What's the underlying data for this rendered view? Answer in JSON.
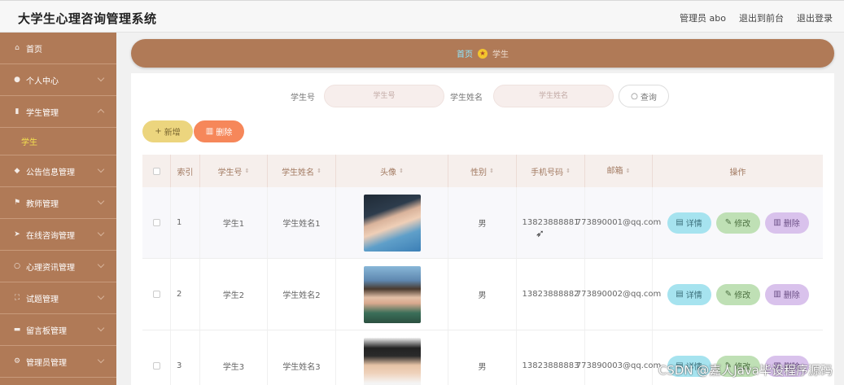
{
  "header": {
    "title": "大学生心理咨询管理系统",
    "admin_label": "管理员 abo",
    "to_front": "退出到前台",
    "logout": "退出登录"
  },
  "sidebar": {
    "items": [
      {
        "label": "首页",
        "icon": "home-icon"
      },
      {
        "label": "个人中心",
        "icon": "user-icon"
      },
      {
        "label": "学生管理",
        "icon": "bar-chart-icon",
        "submenu": "学生"
      },
      {
        "label": "公告信息管理",
        "icon": "bell-icon"
      },
      {
        "label": "教师管理",
        "icon": "flag-icon"
      },
      {
        "label": "在线咨询管理",
        "icon": "send-icon"
      },
      {
        "label": "心理资讯管理",
        "icon": "circle-icon"
      },
      {
        "label": "试题管理",
        "icon": "expand-icon"
      },
      {
        "label": "留言板管理",
        "icon": "briefcase-icon"
      },
      {
        "label": "管理员管理",
        "icon": "settings-icon"
      }
    ]
  },
  "breadcrumb": {
    "home": "首页",
    "current": "学生"
  },
  "search": {
    "student_no_label": "学生号",
    "student_no_placeholder": "学生号",
    "student_name_label": "学生姓名",
    "student_name_placeholder": "学生姓名",
    "query_button": "查询"
  },
  "toolbar": {
    "add_label": "新增",
    "delete_label": "删除"
  },
  "table": {
    "headers": {
      "index": "索引",
      "student_no": "学生号",
      "student_name": "学生姓名",
      "avatar": "头像",
      "gender": "性别",
      "phone": "手机号码",
      "email": "邮箱",
      "actions": "操作"
    },
    "rows": [
      {
        "index": "1",
        "student_no": "学生1",
        "student_name": "学生姓名1",
        "gender": "男",
        "phone": "13823888881",
        "email": "773890001@qq.com"
      },
      {
        "index": "2",
        "student_no": "学生2",
        "student_name": "学生姓名2",
        "gender": "男",
        "phone": "13823888882",
        "email": "773890002@qq.com"
      },
      {
        "index": "3",
        "student_no": "学生3",
        "student_name": "学生姓名3",
        "gender": "男",
        "phone": "13823888883",
        "email": "773890003@qq.com"
      }
    ],
    "actions": {
      "detail": "详情",
      "edit": "修改",
      "remove": "删除"
    }
  },
  "watermark": "CSDN @嘉人Java毕设程序源码"
}
